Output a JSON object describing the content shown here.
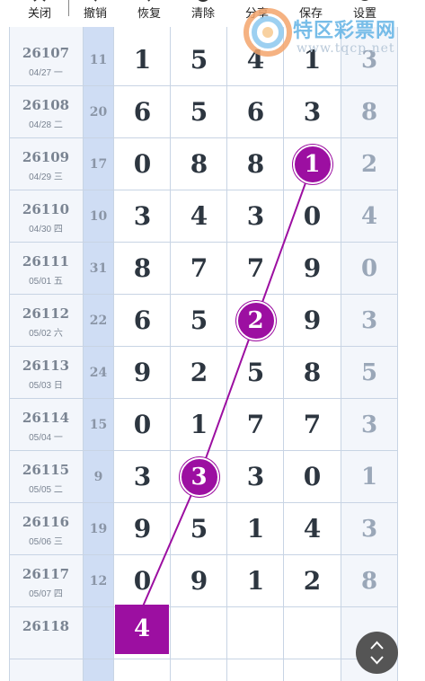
{
  "toolbar": {
    "close_label": "关闭",
    "undo_label": "撤销",
    "redo_label": "恢复",
    "clear_label": "清除",
    "share_label": "分享",
    "save_label": "保存",
    "settings_label": "设置"
  },
  "watermark": {
    "text": "特区彩票网",
    "url": "www.tqcp.net"
  },
  "rows": [
    {
      "issue": "26107",
      "date": "04/27 一",
      "sum": "11",
      "digits": [
        "1",
        "5",
        "4",
        "1"
      ],
      "last": "3"
    },
    {
      "issue": "26108",
      "date": "04/28 二",
      "sum": "20",
      "digits": [
        "6",
        "5",
        "6",
        "3"
      ],
      "last": "8"
    },
    {
      "issue": "26109",
      "date": "04/29 三",
      "sum": "17",
      "digits": [
        "0",
        "8",
        "8",
        "1"
      ],
      "last": "2"
    },
    {
      "issue": "26110",
      "date": "04/30 四",
      "sum": "10",
      "digits": [
        "3",
        "4",
        "3",
        "0"
      ],
      "last": "4"
    },
    {
      "issue": "26111",
      "date": "05/01 五",
      "sum": "31",
      "digits": [
        "8",
        "7",
        "7",
        "9"
      ],
      "last": "0"
    },
    {
      "issue": "26112",
      "date": "05/02 六",
      "sum": "22",
      "digits": [
        "6",
        "5",
        "2",
        "9"
      ],
      "last": "3"
    },
    {
      "issue": "26113",
      "date": "05/03 日",
      "sum": "24",
      "digits": [
        "9",
        "2",
        "5",
        "8"
      ],
      "last": "5"
    },
    {
      "issue": "26114",
      "date": "05/04 一",
      "sum": "15",
      "digits": [
        "0",
        "1",
        "7",
        "7"
      ],
      "last": "3"
    },
    {
      "issue": "26115",
      "date": "05/05 二",
      "sum": "9",
      "digits": [
        "3",
        "3",
        "3",
        "0"
      ],
      "last": "1"
    },
    {
      "issue": "26116",
      "date": "05/06 三",
      "sum": "19",
      "digits": [
        "9",
        "5",
        "1",
        "4"
      ],
      "last": "3"
    },
    {
      "issue": "26117",
      "date": "05/07 四",
      "sum": "12",
      "digits": [
        "0",
        "9",
        "1",
        "2"
      ],
      "last": "8"
    },
    {
      "issue": "26118",
      "date": "",
      "sum": "",
      "digits": [
        "",
        "",
        "",
        ""
      ],
      "last": ""
    }
  ],
  "markers": [
    {
      "label": "1",
      "row": 2,
      "col": 3
    },
    {
      "label": "2",
      "row": 5,
      "col": 2
    },
    {
      "label": "3",
      "row": 8,
      "col": 1
    },
    {
      "label": "4",
      "row": 11,
      "col": 0
    }
  ],
  "colors": {
    "marker": "#9c0fa1",
    "sum_column_bg": "#cfddf4",
    "issue_column_bg": "#f3f6fb",
    "last_column_bg": "#f3f6fb"
  }
}
